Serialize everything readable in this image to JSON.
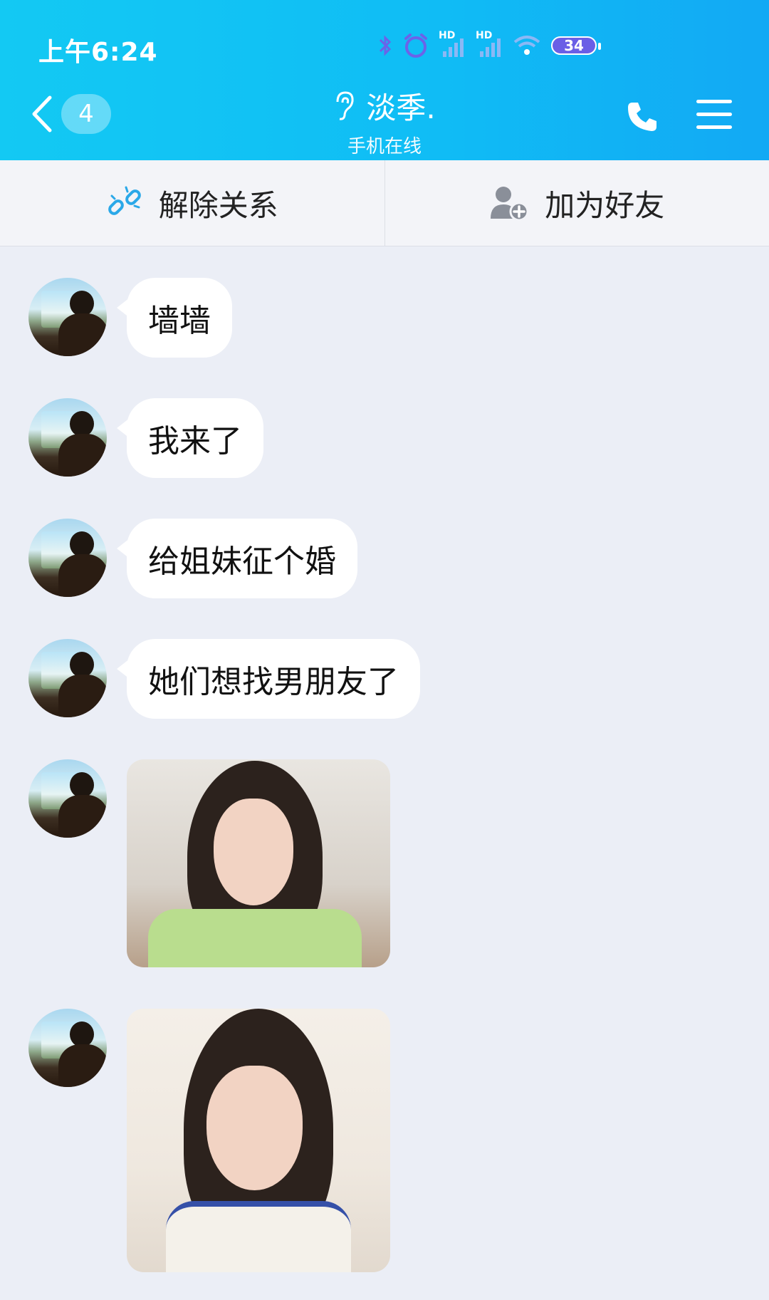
{
  "status_bar": {
    "time": "上午6:24",
    "signal1_label": "HD",
    "signal2_label": "HD",
    "battery": "34"
  },
  "header": {
    "unread_count": "4",
    "contact_name": "淡季.",
    "contact_status": "手机在线",
    "icons": [
      "back-arrow-icon",
      "ear-icon",
      "phone-icon",
      "menu-icon"
    ]
  },
  "actions": {
    "remove_relation": "解除关系",
    "add_friend": "加为好友"
  },
  "messages": [
    {
      "type": "text",
      "text": "墙墙"
    },
    {
      "type": "text",
      "text": "我来了"
    },
    {
      "type": "text",
      "text": "给姐妹征个婚"
    },
    {
      "type": "text",
      "text": "她们想找男朋友了"
    },
    {
      "type": "image",
      "description": "photo"
    },
    {
      "type": "image",
      "description": "photo"
    }
  ],
  "colors": {
    "header_gradient_start": "#13c9f3",
    "header_gradient_end": "#12a9f4",
    "background": "#ebeef6",
    "bubble": "#ffffff"
  }
}
